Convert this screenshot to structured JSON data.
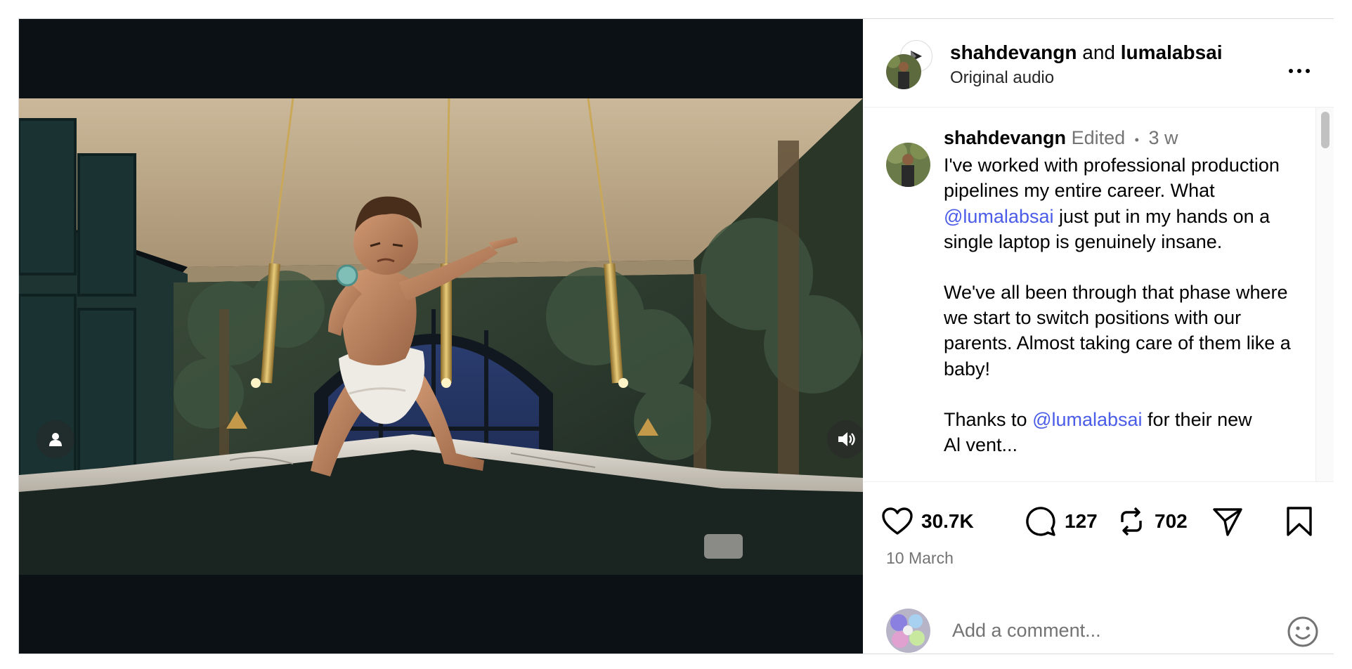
{
  "header": {
    "user1": "shahdevangn",
    "joiner": "and",
    "user2": "lumalabsai",
    "audio": "Original audio",
    "more_icon": "more-horizontal-icon"
  },
  "caption": {
    "username": "shahdevangn",
    "edited": "Edited",
    "dot": "•",
    "age": "3 w",
    "p1_a": "I've worked with professional production pipelines my entire career. What ",
    "p1_mention": "@lumalabsai",
    "p1_b": " just put in my hands on a single laptop is genuinely insane.",
    "p2": "We've all been through that phase where we start to switch positions with our parents. Almost taking care of them like a baby!",
    "p3_a": "Thanks to ",
    "p3_mention": "@lumalabsai",
    "p3_b": " for their new",
    "p3_cut": "Al vent..."
  },
  "actions": {
    "likes": "30.7K",
    "comments": "127",
    "reposts": "702",
    "like_icon": "heart-icon",
    "comment_icon": "comment-bubble-icon",
    "repost_icon": "repost-icon",
    "share_icon": "send-icon",
    "save_icon": "bookmark-icon"
  },
  "date": "10 March",
  "comment_box": {
    "placeholder": "Add a comment...",
    "emoji_icon": "emoji-icon"
  },
  "video": {
    "user_tag_icon": "user-tag-icon",
    "audio_icon": "volume-icon"
  },
  "colors": {
    "mention": "#4a5ce8",
    "muted": "#737373",
    "media_bg": "#0c1116"
  }
}
